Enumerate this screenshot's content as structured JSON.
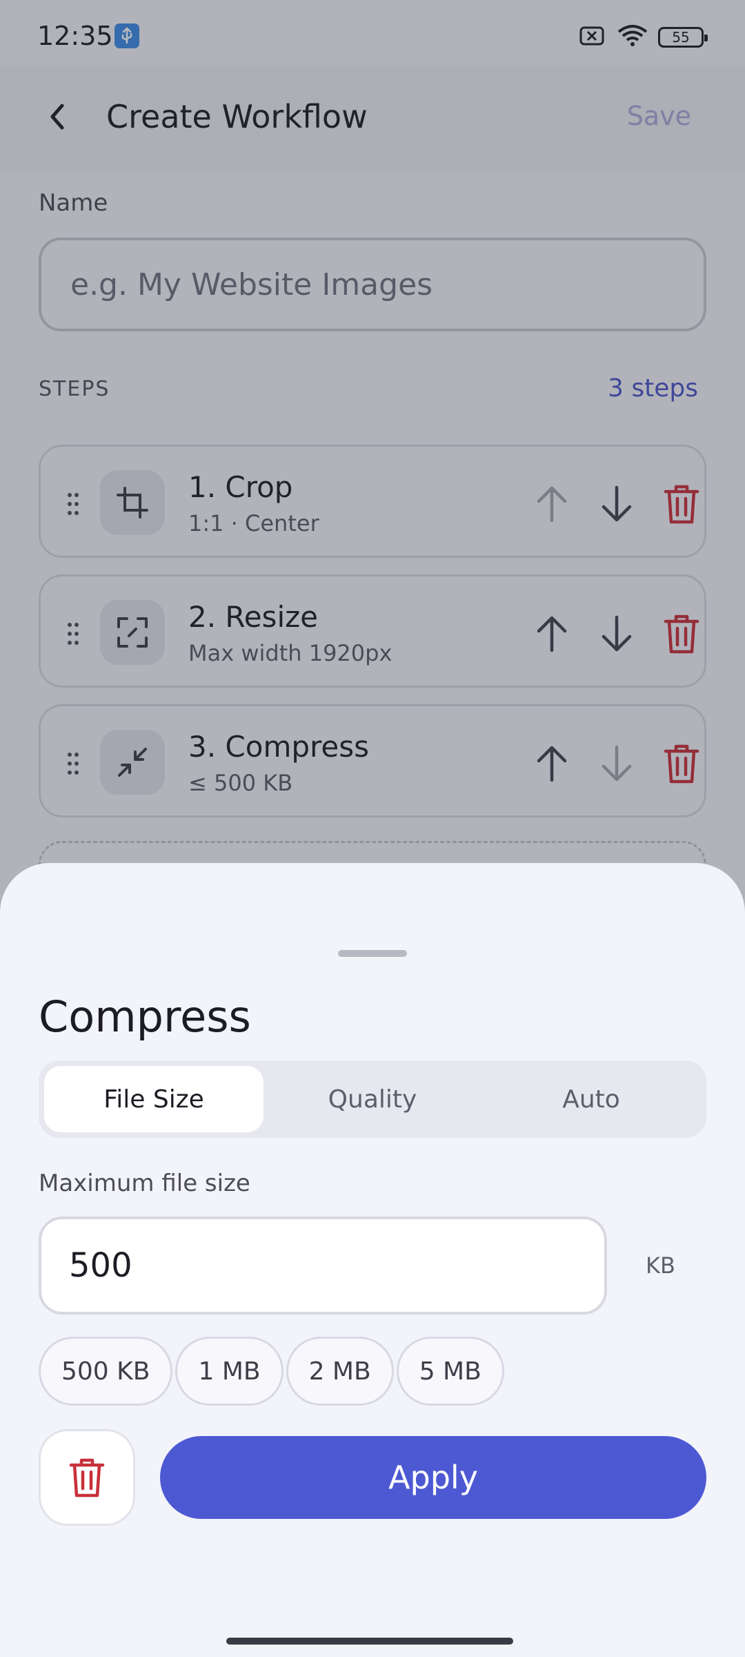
{
  "status_bar": {
    "time": "12:35",
    "battery": "55"
  },
  "app_bar": {
    "title": "Create Workflow",
    "save_label": "Save"
  },
  "form": {
    "name_label": "Name",
    "name_placeholder": "e.g. My Website Images",
    "steps_label": "STEPS",
    "steps_count": "3 steps"
  },
  "steps": [
    {
      "title": "1. Crop",
      "subtitle": "1:1 · Center",
      "icon": "crop-icon",
      "can_move_up": false,
      "can_move_down": true
    },
    {
      "title": "2. Resize",
      "subtitle": "Max width 1920px",
      "icon": "resize-icon",
      "can_move_up": true,
      "can_move_down": true
    },
    {
      "title": "3. Compress",
      "subtitle": "≤ 500 KB",
      "icon": "compress-icon",
      "can_move_up": true,
      "can_move_down": false
    }
  ],
  "sheet": {
    "title": "Compress",
    "tabs": [
      {
        "label": "File Size",
        "active": true
      },
      {
        "label": "Quality",
        "active": false
      },
      {
        "label": "Auto",
        "active": false
      }
    ],
    "field_label": "Maximum file size",
    "value": "500",
    "unit": "KB",
    "presets": [
      "500 KB",
      "1 MB",
      "2 MB",
      "5 MB"
    ],
    "apply_label": "Apply"
  },
  "colors": {
    "accent": "#4d59d3",
    "danger": "#c8303b"
  }
}
